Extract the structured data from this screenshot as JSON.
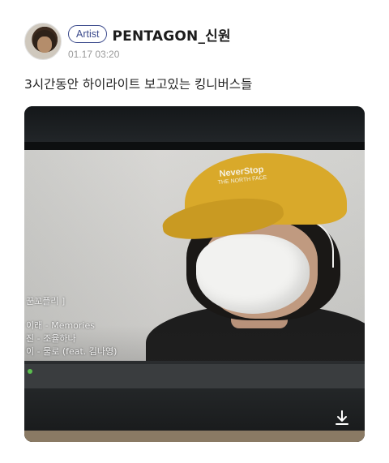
{
  "post": {
    "badge": "Artist",
    "author": "PENTAGON_신원",
    "timestamp": "01.17 03:20",
    "text": "3시간동안 하이라이트 보고있는 킹니버스들"
  },
  "media": {
    "cap_logo": "NeverStop",
    "cap_logo_sub": "THE NORTH FACE",
    "subtitles": [
      "꾼꼬플리 ]",
      "이래 - Memories",
      "진 - 조율하나",
      "이 - 물로 (feat. 김나영)"
    ],
    "download_icon": "download-icon"
  }
}
